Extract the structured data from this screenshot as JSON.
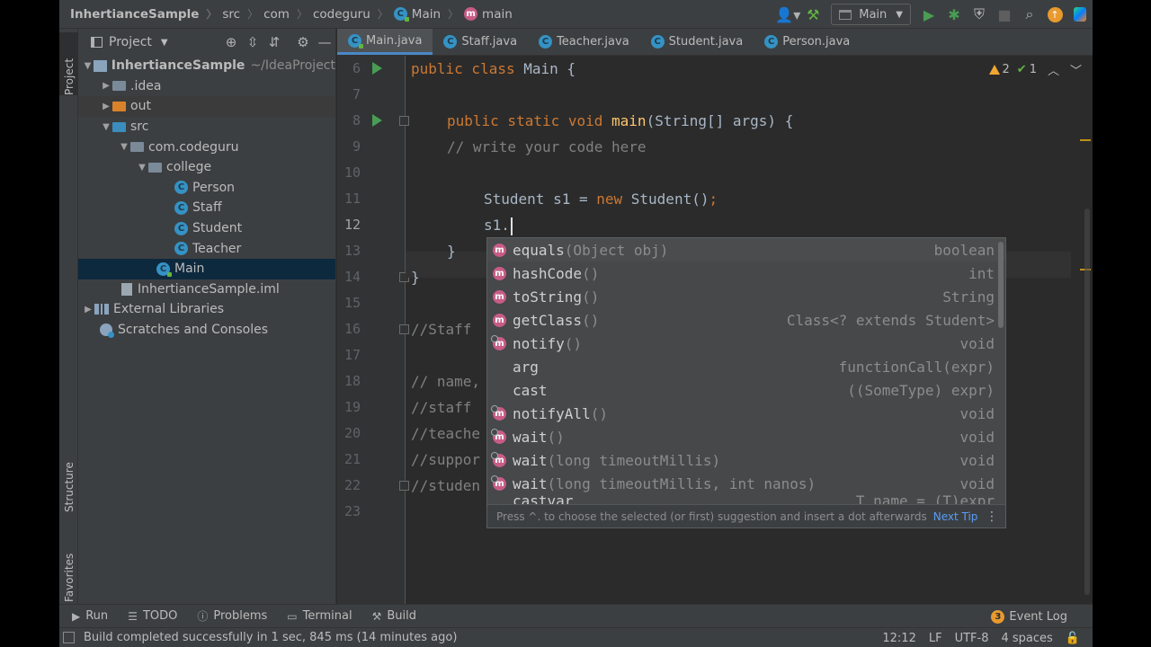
{
  "navbar": {
    "crumbs": [
      "InhertianceSample",
      "src",
      "com",
      "codeguru",
      "Main",
      "main"
    ],
    "run_config": "Main"
  },
  "left_strip": {
    "project": "Project",
    "structure": "Structure",
    "favorites": "Favorites"
  },
  "project_panel": {
    "title": "Project",
    "tree": [
      {
        "label": "InhertianceSample",
        "suffix": "~/IdeaProject"
      },
      {
        "label": ".idea"
      },
      {
        "label": "out"
      },
      {
        "label": "src"
      },
      {
        "label": "com.codeguru"
      },
      {
        "label": "college"
      },
      {
        "label": "Person"
      },
      {
        "label": "Staff"
      },
      {
        "label": "Student"
      },
      {
        "label": "Teacher"
      },
      {
        "label": "Main"
      },
      {
        "label": "InhertianceSample.iml"
      },
      {
        "label": "External Libraries"
      },
      {
        "label": "Scratches and Consoles"
      }
    ]
  },
  "tabs": [
    "Main.java",
    "Staff.java",
    "Teacher.java",
    "Student.java",
    "Person.java"
  ],
  "inspections": {
    "warnings": "2",
    "ok": "1"
  },
  "code": {
    "line_numbers": [
      "6",
      "7",
      "8",
      "9",
      "10",
      "11",
      "12",
      "13",
      "14",
      "15",
      "16",
      "17",
      "18",
      "19",
      "20",
      "21",
      "22",
      "23"
    ],
    "l6_kw": "public class ",
    "l6_rest": "Main {",
    "l8_kw": "public static void ",
    "l8_fn": "main",
    "l8_rest": "(String[] args) {",
    "l9": "// write your code here",
    "l11_a": "Student s1 = ",
    "l11_kw": "new",
    "l11_b": " Student()",
    "l11_semi": ";",
    "l12": "s1.",
    "l13": "}",
    "l14": "}",
    "l16": "//Staff",
    "l18": "// name,",
    "l19": "//staff",
    "l20": "//teache",
    "l21": "//suppor",
    "l22": "//studen"
  },
  "completion": {
    "items": [
      {
        "name": "equals",
        "params": "(Object obj)",
        "type": "boolean"
      },
      {
        "name": "hashCode",
        "params": "()",
        "type": "int"
      },
      {
        "name": "toString",
        "params": "()",
        "type": "String"
      },
      {
        "name": "getClass",
        "params": "()",
        "type": "Class<? extends Student>"
      },
      {
        "name": "notify",
        "params": "()",
        "type": "void"
      },
      {
        "name": "arg",
        "params": "",
        "type": "functionCall(expr)"
      },
      {
        "name": "cast",
        "params": "",
        "type": "((SomeType) expr)"
      },
      {
        "name": "notifyAll",
        "params": "()",
        "type": "void"
      },
      {
        "name": "wait",
        "params": "()",
        "type": "void"
      },
      {
        "name": "wait",
        "params": "(long timeoutMillis)",
        "type": "void"
      },
      {
        "name": "wait",
        "params": "(long timeoutMillis, int nanos)",
        "type": "void"
      },
      {
        "name": "castvar",
        "params": "",
        "type": "T name = (T)expr"
      }
    ],
    "footer_hint": "Press ^. to choose the selected (or first) suggestion and insert a dot afterwards",
    "footer_link": "Next Tip"
  },
  "bottom_tools": [
    "Run",
    "TODO",
    "Problems",
    "Terminal",
    "Build"
  ],
  "event_log": {
    "badge": "3",
    "label": "Event Log"
  },
  "status": {
    "message": "Build completed successfully in 1 sec, 845 ms (14 minutes ago)",
    "position": "12:12",
    "line_sep": "LF",
    "encoding": "UTF-8",
    "indent": "4 spaces"
  }
}
